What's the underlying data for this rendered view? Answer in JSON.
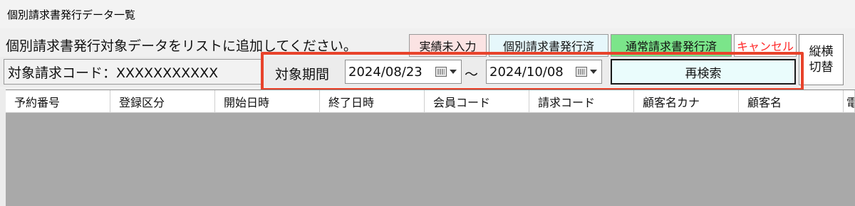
{
  "window": {
    "title": "個別請求書発行データ一覧"
  },
  "instruction": "個別請求書発行対象データをリストに追加してください。",
  "legend": {
    "actual_not_entered": "実績未入力",
    "individual_issued": "個別請求書発行済",
    "normal_issued": "通常請求書発行済",
    "cancel": "キャンセル"
  },
  "toggle": {
    "line1": "縦横",
    "line2": "切替"
  },
  "billing_code": {
    "label": "対象請求コード：XXXXXXXXXXX"
  },
  "period": {
    "label": "対象期間",
    "start": "2024/08/23",
    "separator": "～",
    "end": "2024/10/08"
  },
  "search_button": "再検索",
  "grid": {
    "columns": [
      "予約番号",
      "登録区分",
      "開始日時",
      "終了日時",
      "会員コード",
      "請求コード",
      "顧客名カナ",
      "顧客名",
      "電"
    ]
  },
  "colors": {
    "actual_not_entered": "#fbe3e3",
    "individual_issued": "#e6f7fb",
    "normal_issued": "#7be58a",
    "cancel_text": "#ff2a2a",
    "highlight": "#e8432b",
    "grid_empty": "#a9a9a9"
  }
}
